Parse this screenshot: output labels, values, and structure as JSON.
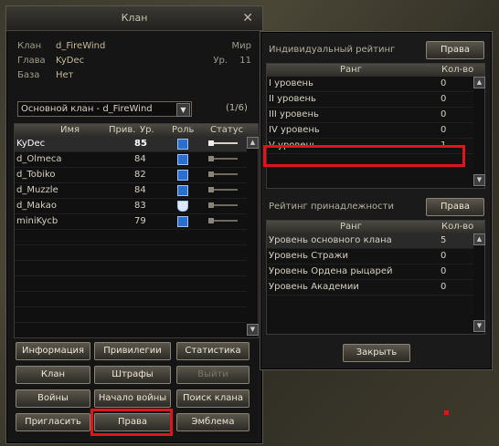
{
  "clan_window": {
    "title": "Клан",
    "info": {
      "clan_label": "Клан",
      "clan_value": "d_FireWind",
      "world_label": "Мир",
      "leader_label": "Глава",
      "leader_value": "KyDec",
      "level_label": "Ур.",
      "level_value": "11",
      "base_label": "База",
      "base_value": "Нет"
    },
    "clan_select": "Основной клан - d_FireWind",
    "member_count": "(1/6)",
    "columns": {
      "name": "Имя",
      "priv": "Прив.",
      "level": "Ур.",
      "role": "Роль",
      "status": "Статус"
    },
    "members": [
      {
        "name": "KyDec",
        "level": "85",
        "role_icon": "sword-icon"
      },
      {
        "name": "d_Olmeca",
        "level": "84",
        "role_icon": "sword-icon"
      },
      {
        "name": "d_Tobiko",
        "level": "82",
        "role_icon": "sword-icon"
      },
      {
        "name": "d_Muzzle",
        "level": "84",
        "role_icon": "sword-icon"
      },
      {
        "name": "d_Makao",
        "level": "83",
        "role_icon": "shield-icon"
      },
      {
        "name": "miniKycb",
        "level": "79",
        "role_icon": "sword-icon"
      }
    ],
    "buttons": {
      "info": "Информация",
      "privileges": "Привилегии",
      "stats": "Статистика",
      "clan": "Клан",
      "penalties": "Штрафы",
      "leave": "Выйти",
      "wars": "Войны",
      "start_war": "Начало войны",
      "search": "Поиск клана",
      "invite": "Пригласить",
      "rights": "Права",
      "emblem": "Эмблема"
    }
  },
  "rating_window": {
    "individual_title": "Индивидуальный рейтинг",
    "individual_rights": "Права",
    "col_rank": "Ранг",
    "col_count": "Кол-во",
    "individual_rows": [
      {
        "rank": "I уровень",
        "count": "0"
      },
      {
        "rank": "II уровень",
        "count": "0"
      },
      {
        "rank": "III уровень",
        "count": "0"
      },
      {
        "rank": "IV уровень",
        "count": "0"
      },
      {
        "rank": "V уровень",
        "count": "1"
      }
    ],
    "membership_title": "Рейтинг принадлежности",
    "membership_rights": "Права",
    "membership_rows": [
      {
        "rank": "Уровень основного клана",
        "count": "5"
      },
      {
        "rank": "Уровень Стражи",
        "count": "0"
      },
      {
        "rank": "Уровень Ордена рыцарей",
        "count": "0"
      },
      {
        "rank": "Уровень Академии",
        "count": "0"
      }
    ],
    "close": "Закрыть"
  },
  "colors": {
    "highlight": "#e3121b",
    "accent": "#2a6fd0"
  }
}
